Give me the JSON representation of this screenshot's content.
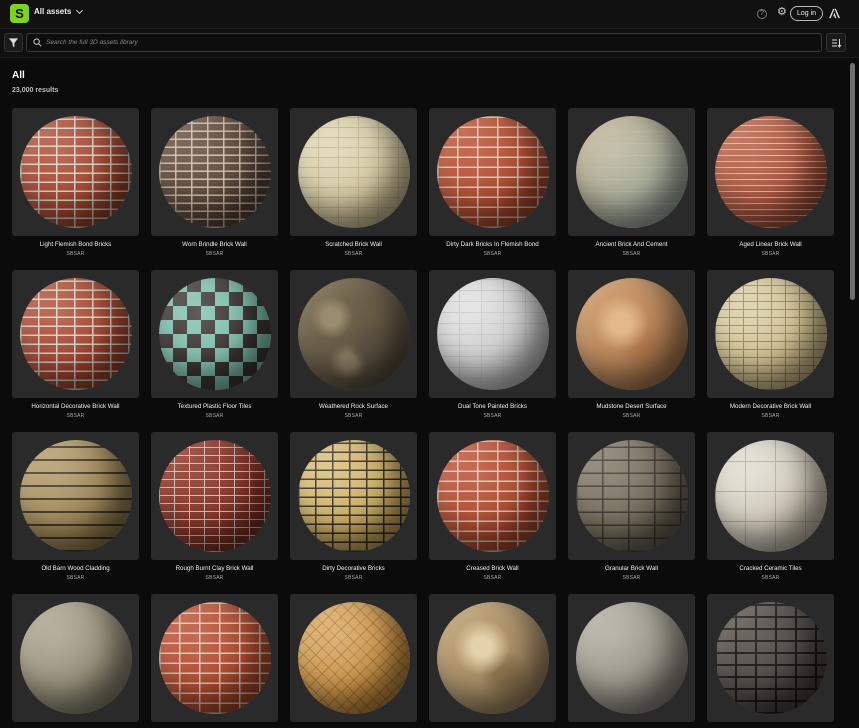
{
  "header": {
    "logo_letter": "S",
    "assets_menu_label": "All assets",
    "help_glyph": "?",
    "login_label": "Log in"
  },
  "search": {
    "placeholder": "Search the full 3D assets library"
  },
  "page": {
    "title": "All",
    "results": "23,000 results"
  },
  "colors": {
    "brand": "#7ed321",
    "background": "#0b0b0b",
    "card": "#2a2a2a"
  },
  "assets": [
    {
      "title": "Light Flemish Bond Bricks",
      "author": "SBSAR"
    },
    {
      "title": "Worn Brindle Brick Wall",
      "author": "SBSAR"
    },
    {
      "title": "Scratched Brick Wall",
      "author": "SBSAR"
    },
    {
      "title": "Dirty Dark Bricks In Flemish Bond",
      "author": "SBSAR"
    },
    {
      "title": "Ancient Brick And Cement",
      "author": "SBSAR"
    },
    {
      "title": "Aged Linear Brick Wall",
      "author": "SBSAR"
    },
    {
      "title": "Horizontal Decorative Brick Wall",
      "author": "SBSAR"
    },
    {
      "title": "Textured Plastic Floor Tiles",
      "author": "SBSAR"
    },
    {
      "title": "Weathered Rock Surface",
      "author": "SBSAR"
    },
    {
      "title": "Dual Tone Painted Bricks",
      "author": "SBSAR"
    },
    {
      "title": "Mudstone Desert Surface",
      "author": "SBSAR"
    },
    {
      "title": "Modern Decorative Brick Wall",
      "author": "SBSAR"
    },
    {
      "title": "Old Barn Wood Cladding",
      "author": "SBSAR"
    },
    {
      "title": "Rough Burnt Clay Brick Wall",
      "author": "SBSAR"
    },
    {
      "title": "Dirty Decorative Bricks",
      "author": "SBSAR"
    },
    {
      "title": "Creased Brick Wall",
      "author": "SBSAR"
    },
    {
      "title": "Granular Brick Wall",
      "author": "SBSAR"
    },
    {
      "title": "Cracked Ceramic Tiles",
      "author": "SBSAR"
    },
    {
      "title": "",
      "author": ""
    },
    {
      "title": "",
      "author": ""
    },
    {
      "title": "",
      "author": ""
    },
    {
      "title": "",
      "author": ""
    },
    {
      "title": "",
      "author": ""
    },
    {
      "title": "",
      "author": ""
    }
  ]
}
